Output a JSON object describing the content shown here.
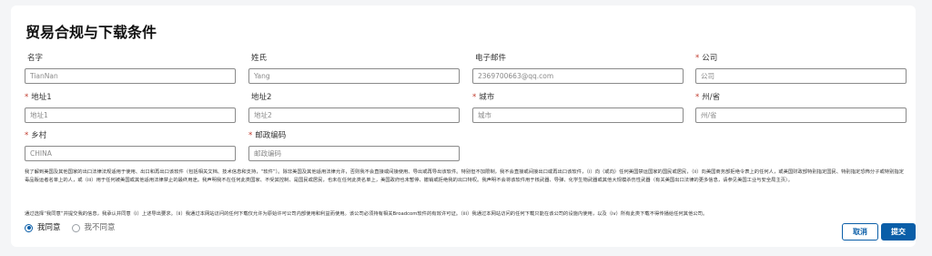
{
  "page": {
    "title": "贸易合规与下载条件"
  },
  "form": {
    "first_name": {
      "label": "名字",
      "required": "",
      "value": "",
      "placeholder": "TianNan"
    },
    "last_name": {
      "label": "姓氏",
      "required": "",
      "value": "",
      "placeholder": "Yang"
    },
    "email": {
      "label": "电子邮件",
      "required": "",
      "value": "",
      "placeholder": "2369700663@qq.com"
    },
    "company": {
      "label": "公司",
      "required": "*",
      "value": "",
      "placeholder": "公司"
    },
    "address1": {
      "label": "地址1",
      "required": "*",
      "value": "",
      "placeholder": "地址1"
    },
    "address2": {
      "label": "地址2",
      "required": "",
      "value": "",
      "placeholder": "地址2"
    },
    "city": {
      "label": "城市",
      "required": "*",
      "value": "",
      "placeholder": "城市"
    },
    "state": {
      "label": "州/省",
      "required": "*",
      "value": "",
      "placeholder": "州/省"
    },
    "country": {
      "label": "乡村",
      "required": "*",
      "value": "",
      "placeholder": "CHINA"
    },
    "postal_code": {
      "label": "邮政编码",
      "required": "*",
      "value": "",
      "placeholder": "邮政编码"
    }
  },
  "legal_text": "我了解到美国及其他国家的出口法律法规适用于使用、出口和再出口该软件（包括相关文档、技术信息和支持，“软件”）。除非美国及其他适用法律允许，否则我不会直接或间接使用、导出或再导出该软件。特别但不加限制，我不会直接或间接出口或再出口该软件，（i）向（或向）任何美国禁运国家的国民或居民，（ii）向美国商务部拒绝令表上的任何人，或美国财政部特别指定国民、特别指定恐怖分子或特别指定毒品贩运者名单上的人，或（iii）用于任何被美国或其他适用法律禁止的最终用途。我声明我不在任何此类国家、不受其控制、是国民或居民，也未在任何此类名单上，美国政府也未暂停、撤销或拒绝我的出口特权。我声明不会将该软件用于核武器、导弹、化学生物武器或其他大规模杀伤性武器（有关美国出口法律的更多信息，请参见美国工业与安全局主页）。",
  "consent_text": "通过选择“我同意”并提交我的信息，我承认并同意（i）上述导出要求。（ii）我通过本网站访问的任何下载仅允许为原始许可公司内部使用和利益而使用。该公司必须持有相关Broadcom软件的有效许可证。（iii）我通过本网站访问的任何下载只能在该公司的设施内使用，以及（iv）所有此类下载不得传播给任何其他公司。",
  "agreement": {
    "agree_label": "我同意",
    "disagree_label": "我不同意",
    "selected": "agree"
  },
  "buttons": {
    "cancel": "取消",
    "submit": "提交"
  },
  "colors": {
    "accent": "#0a5ea8",
    "required": "#c0392b",
    "background": "#f4f5f7"
  }
}
